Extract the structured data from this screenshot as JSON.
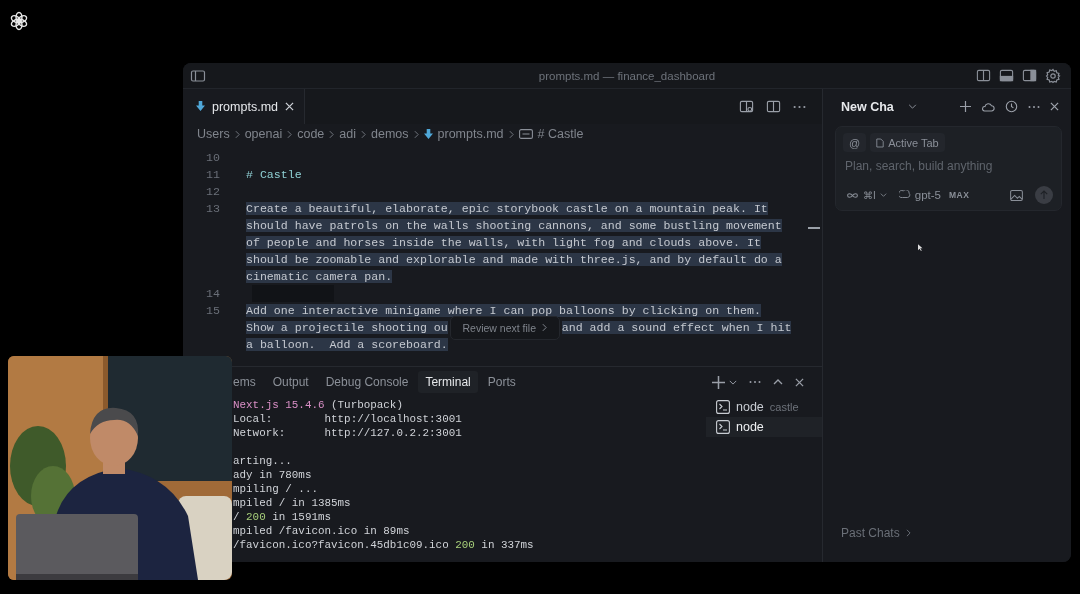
{
  "window": {
    "title": "prompts.md — finance_dashboard"
  },
  "editor": {
    "tabs": [
      {
        "label": "prompts.md",
        "selected": true
      }
    ],
    "breadcrumb": [
      {
        "label": "Users",
        "kind": "folder"
      },
      {
        "label": "openai",
        "kind": "folder"
      },
      {
        "label": "code",
        "kind": "folder"
      },
      {
        "label": "adi",
        "kind": "folder"
      },
      {
        "label": "demos",
        "kind": "folder"
      },
      {
        "label": "prompts.md",
        "kind": "file"
      },
      {
        "label": "# Castle",
        "kind": "symbol"
      }
    ],
    "lines": [
      {
        "number": "10",
        "selected": false
      },
      {
        "number": "11",
        "kind": "heading",
        "selected": false,
        "rows": [
          [
            "# Castle"
          ]
        ]
      },
      {
        "number": "12",
        "selected": false
      },
      {
        "number": "13",
        "kind": "text",
        "selected": true,
        "rows": [
          [
            "Create a beautiful, elaborate, epic storybook castle on a mountain peak. It"
          ],
          [
            "should have patrols on the walls shooting cannons, and some bustling movement"
          ],
          [
            "of people and horses inside the walls, with light fog and clouds above. It"
          ],
          [
            "should be zoomable and explorable and made with three.js, and by default do a"
          ],
          [
            "cinematic camera pan."
          ]
        ]
      },
      {
        "number": "14",
        "selected": true
      },
      {
        "number": "15",
        "kind": "text",
        "selected": true,
        "rows": [
          [
            "Add one interactive minigame where I can pop balloons by clicking on them."
          ],
          [
            "Show a projectile shooting ou",
            "and add a sound effect when I hit"
          ],
          [
            "a balloon.  Add a scoreboard."
          ]
        ]
      }
    ],
    "review_button": "Review next file"
  },
  "panel": {
    "tabs": [
      {
        "label": "ems",
        "selected": false
      },
      {
        "label": "Output",
        "selected": false
      },
      {
        "label": "Debug Console",
        "selected": false
      },
      {
        "label": "Terminal",
        "selected": true
      },
      {
        "label": "Ports",
        "selected": false
      }
    ],
    "terminal": [
      {
        "segments": [
          {
            "text": "Next.js 15.4.6",
            "kind": "accent"
          },
          {
            "text": " (Turbopack)",
            "kind": "plain"
          }
        ]
      },
      {
        "segments": [
          {
            "text": "Local:        http://localhost:3001",
            "kind": "plain"
          }
        ]
      },
      {
        "segments": [
          {
            "text": "Network:      http://127.0.2.2:3001",
            "kind": "plain"
          }
        ]
      },
      {
        "spaced": true,
        "segments": [
          {
            "text": "arting...",
            "kind": "plain"
          }
        ]
      },
      {
        "segments": [
          {
            "text": "ady in 780ms",
            "kind": "plain"
          }
        ]
      },
      {
        "segments": [
          {
            "text": "mpiling / ...",
            "kind": "plain"
          }
        ]
      },
      {
        "segments": [
          {
            "text": "mpiled / in 1385ms",
            "kind": "plain"
          }
        ]
      },
      {
        "segments": [
          {
            "text": "/ ",
            "kind": "plain"
          },
          {
            "text": "200",
            "kind": "success"
          },
          {
            "text": " in 1591ms",
            "kind": "plain"
          }
        ]
      },
      {
        "segments": [
          {
            "text": "mpiled /favicon.ico in 89ms",
            "kind": "plain"
          }
        ]
      },
      {
        "segments": [
          {
            "text": "/favicon.ico?favicon.45db1c09.ico ",
            "kind": "plain"
          },
          {
            "text": "200",
            "kind": "success"
          },
          {
            "text": " in 337ms",
            "kind": "plain"
          }
        ]
      }
    ],
    "instances": [
      {
        "label": "node",
        "detail": "castle",
        "selected": false
      },
      {
        "label": "node",
        "selected": true
      }
    ]
  },
  "chat": {
    "title": "New Cha",
    "mention": "@",
    "context_chip": "Active Tab",
    "placeholder": "Plan, search, build anything",
    "mode_shortcut": "⌘I",
    "model": "gpt-5",
    "model_badge": "MAX",
    "send_disabled": true,
    "past_chats": "Past Chats"
  }
}
